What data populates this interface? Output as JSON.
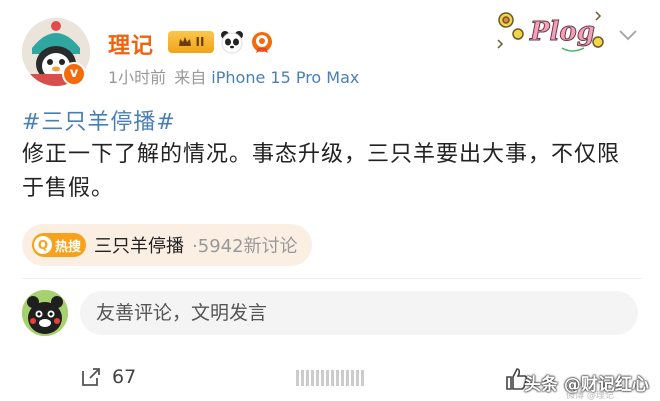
{
  "post": {
    "username": "理记",
    "rank_badge": "II",
    "time": "1小时前",
    "source_prefix": "来自",
    "device": "iPhone 15 Pro Max",
    "sticker_text": "Plog",
    "verified_mark": "v",
    "hashtag": "#三只羊停播#",
    "content": "修正一下了解的情况。事态升级，三只羊要出大事，不仅限于售假。"
  },
  "hot_search": {
    "logo_label": "热搜",
    "logo_glyph": "Q",
    "title": "三只羊停播",
    "separator": "·",
    "count": "5942新讨论"
  },
  "comment": {
    "placeholder": "友善评论，文明发言"
  },
  "actions": {
    "repost_count": "67",
    "watermark": "头条 @财记红心",
    "watermark_sub": "微博 @理记"
  },
  "colors": {
    "username": "#f0620c",
    "link": "#4a7fb5",
    "hot_bg": "#fbefe4",
    "hot_logo": "#f7a21a"
  }
}
